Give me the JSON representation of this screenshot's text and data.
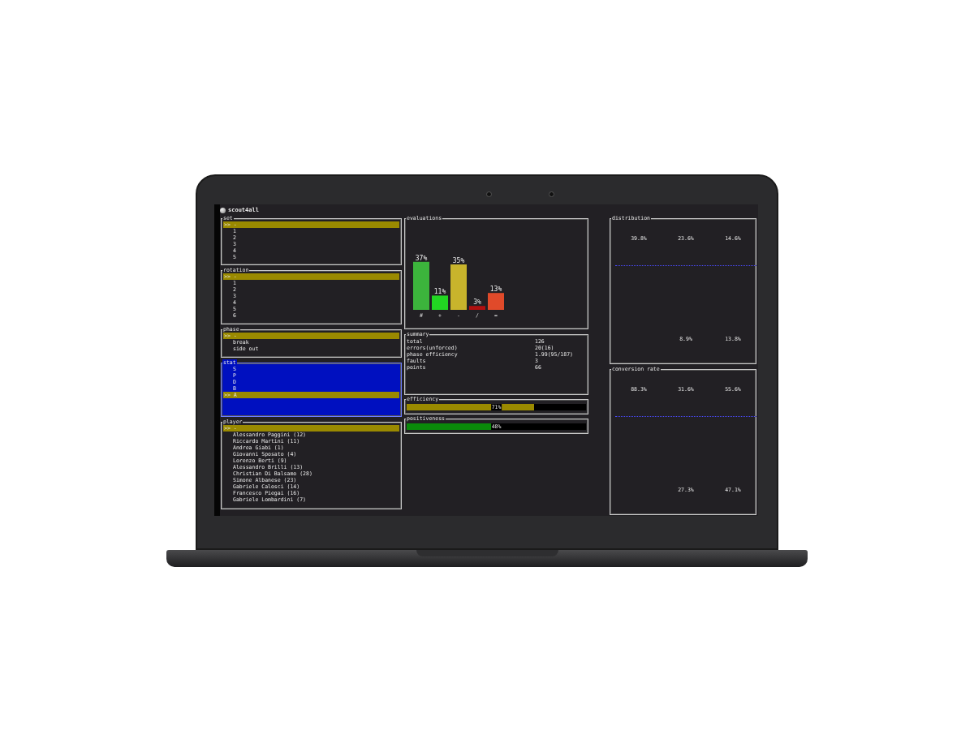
{
  "window": {
    "title": "scout4all"
  },
  "cursor": ">>",
  "left_panels": [
    {
      "title": "set",
      "focused": false,
      "items": [
        {
          "label": "-",
          "selected": true
        },
        {
          "label": "1",
          "selected": false
        },
        {
          "label": "2",
          "selected": false
        },
        {
          "label": "3",
          "selected": false
        },
        {
          "label": "4",
          "selected": false
        },
        {
          "label": "5",
          "selected": false
        }
      ]
    },
    {
      "title": "rotation",
      "focused": false,
      "items": [
        {
          "label": "-",
          "selected": true
        },
        {
          "label": "1",
          "selected": false
        },
        {
          "label": "2",
          "selected": false
        },
        {
          "label": "3",
          "selected": false
        },
        {
          "label": "4",
          "selected": false
        },
        {
          "label": "5",
          "selected": false
        },
        {
          "label": "6",
          "selected": false
        }
      ]
    },
    {
      "title": "phase",
      "focused": false,
      "items": [
        {
          "label": "-",
          "selected": true
        },
        {
          "label": "break",
          "selected": false
        },
        {
          "label": "side out",
          "selected": false
        }
      ]
    },
    {
      "title": "stat",
      "focused": true,
      "items": [
        {
          "label": "S",
          "selected": false
        },
        {
          "label": "P",
          "selected": false
        },
        {
          "label": "D",
          "selected": false
        },
        {
          "label": "B",
          "selected": false
        },
        {
          "label": "A",
          "selected": true
        }
      ]
    },
    {
      "title": "player",
      "focused": false,
      "items": [
        {
          "label": "-",
          "selected": true
        },
        {
          "label": "Alessandro Paggini (12)",
          "selected": false
        },
        {
          "label": "Riccardo Martini (11)",
          "selected": false
        },
        {
          "label": "Andrea Giabi (1)",
          "selected": false
        },
        {
          "label": "Giovanni Sposato (4)",
          "selected": false
        },
        {
          "label": "Lorenzo Berti (9)",
          "selected": false
        },
        {
          "label": "Alessandro Brilli (13)",
          "selected": false
        },
        {
          "label": "Christian Di Balsamo (28)",
          "selected": false
        },
        {
          "label": "Simone Albanese (23)",
          "selected": false
        },
        {
          "label": "Gabriele Calosci (14)",
          "selected": false
        },
        {
          "label": "Francesco Piegai (16)",
          "selected": false
        },
        {
          "label": "Gabriele Lombardini (7)",
          "selected": false
        }
      ]
    }
  ],
  "evaluations": {
    "title": "evaluations",
    "chart_data": {
      "type": "bar",
      "categories": [
        "#",
        "+",
        "-",
        "/",
        "="
      ],
      "values": [
        37,
        11,
        35,
        3,
        13
      ],
      "value_labels": [
        "37%",
        "11%",
        "35%",
        "3%",
        "13%"
      ]
    }
  },
  "summary": {
    "title": "summary",
    "rows": [
      {
        "label": "total",
        "value": "126"
      },
      {
        "label": "errors(unforced)",
        "value": "20(16)"
      },
      {
        "label": "phase efficiency",
        "value": "1.99(95/187)"
      },
      {
        "label": "faults",
        "value": "3"
      },
      {
        "label": "points",
        "value": "66"
      }
    ]
  },
  "meters": [
    {
      "title": "efficiency",
      "level": 0.71,
      "reading": "71%",
      "color": "#9a8a00"
    },
    {
      "title": "positiveness",
      "level": 0.48,
      "reading": "48%",
      "color": "#0a8a0a"
    }
  ],
  "grids": [
    {
      "title": "distribution",
      "rows": [
        [
          "39.8%",
          "23.6%",
          "14.6%"
        ],
        [
          null,
          "8.9%",
          "13.8%"
        ]
      ]
    },
    {
      "title": "conversion rate",
      "rows": [
        [
          "88.3%",
          "31.6%",
          "55.6%"
        ],
        [
          null,
          "27.3%",
          "47.1%"
        ]
      ]
    }
  ]
}
